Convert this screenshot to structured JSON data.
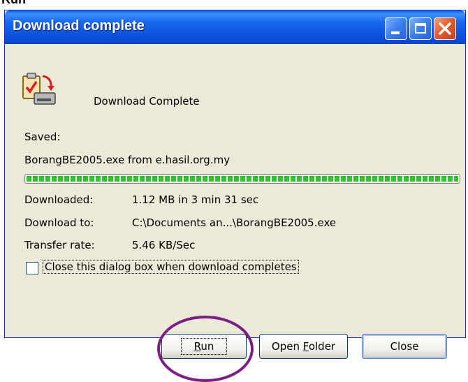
{
  "top_caption": "Run",
  "window": {
    "title": "Download complete",
    "controls": [
      "minimize",
      "maximize",
      "close"
    ]
  },
  "dialog": {
    "headline": "Download Complete",
    "saved_label": "Saved:",
    "saved_file": "BorangBE2005.exe from e.hasil.org.my",
    "progress_percent": 100,
    "progress_color": "#2bc42b",
    "stats": [
      {
        "label": "Downloaded:",
        "value": "1.12 MB in 3 min 31 sec"
      },
      {
        "label": "Download to:",
        "value": "C:\\Documents an...\\BorangBE2005.exe"
      },
      {
        "label": "Transfer rate:",
        "value": "5.46 KB/Sec"
      }
    ],
    "close_checkbox": {
      "label": "Close this dialog box when download completes",
      "checked": false
    }
  },
  "buttons": {
    "run": {
      "mnemonic": "R",
      "rest": "un"
    },
    "open_folder": {
      "pre": "Open ",
      "mnemonic": "F",
      "rest": "older"
    },
    "close": "Close"
  },
  "annotation": {
    "type": "ellipse-highlight",
    "color": "#7b1f82",
    "target": "run-button"
  },
  "colors": {
    "titlebar": "#0a4fd8",
    "window_bg": "#ece9d8",
    "close_button": "#e0582c"
  }
}
